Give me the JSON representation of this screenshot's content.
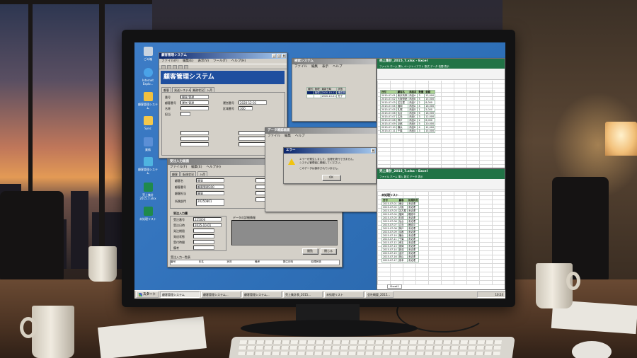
{
  "desktop": {
    "icons": [
      {
        "label": "ごみ箱",
        "icon": "recycle-bin-icon"
      },
      {
        "label": "Internet Explo...",
        "icon": "internet-explorer-icon"
      },
      {
        "label": "顧客管理システム",
        "icon": "app-icon"
      },
      {
        "label": "Sync",
        "icon": "folder-icon"
      },
      {
        "label": "業務",
        "icon": "folder-icon"
      },
      {
        "label": "顧客管理システム",
        "icon": "app-icon"
      },
      {
        "label": "売上集計 2015.7.xlsx",
        "icon": "excel-file-icon"
      },
      {
        "label": "未処理リスト",
        "icon": "excel-file-icon"
      }
    ]
  },
  "main_window": {
    "title": "顧客管理システム",
    "menu": [
      "ファイル(F)",
      "編集(E)",
      "表示(V)",
      "ツール(T)",
      "ヘルプ(H)"
    ],
    "header": "顧客管理システム",
    "tabs": [
      "顧客",
      "発送システム",
      "業務状況",
      "入荷"
    ],
    "labels": [
      "番号",
      "顧客番号",
      "名称",
      "担当"
    ],
    "fields": [
      "開発 管理",
      "運営 管理",
      ""
    ],
    "fields_right_labels": [
      "運営番号",
      "区域番号"
    ],
    "fields_right": [
      "2020-12-01",
      "300"
    ]
  },
  "sub_window": {
    "title": "検索システム",
    "menu": [
      "ファイル",
      "編集",
      "表示",
      "ヘルプ"
    ],
    "headers": [
      "種別",
      "管理",
      "最新日時",
      "状態"
    ],
    "rows": [
      [
        "管理",
        "2020-10-11",
        "確認済"
      ],
      [
        "",
        "2020-10-01",
        "完了"
      ]
    ]
  },
  "input_window": {
    "title": "受注入力画面",
    "menu": [
      "ファイル(F)",
      "編集(E)",
      "ヘルプ(H)"
    ],
    "tabs": [
      "顧客",
      "配達状況",
      "入荷"
    ],
    "labels": [
      "顧客名",
      "顧客番号",
      "顧客担当",
      "所属部門"
    ],
    "fields": [
      "開発",
      "顧客管理300",
      "開発",
      "20250801"
    ],
    "section_labels": [
      "受注入力欄",
      "受注番号",
      "受注日時",
      "発注期限",
      "発送状態",
      "受付時間",
      "備考"
    ],
    "section_fields": [
      "225000",
      "2025-10-01"
    ],
    "data_label": "データの詳細情報",
    "btn_confirm": "閲覧",
    "btn_close": "閉じる",
    "list_title": "受注入力一覧表",
    "list_headers": [
      "番号",
      "氏名",
      "状況",
      "備考",
      "発注日時",
      "処理状態"
    ]
  },
  "dialog": {
    "title": "エラー",
    "parent_title": "データ確認画面",
    "parent_menu": [
      "ファイル",
      "編集",
      "ヘルプ"
    ],
    "message_line1": "エラーが発生しました。処理を続行できません。",
    "message_line2": "システム管理者に連絡してください。",
    "message_line3": "このデータは保存されていません。",
    "ok": "OK"
  },
  "excel_top": {
    "title": "売上集計_2015_7.xlsx - Excel",
    "ribbon_tabs": "ファイル ホーム 挿入 ページレイアウト 数式 データ 校閲 表示",
    "headers": [
      "日付",
      "顧客名",
      "商品名",
      "数量",
      "金額"
    ],
    "rows": [
      [
        "2015-07-01",
        "東京商事",
        "商品A",
        "3",
        "12,000"
      ],
      [
        "2015-07-02",
        "大阪物産",
        "商品B",
        "5",
        "15,000"
      ],
      [
        "2015-07-03",
        "名古屋",
        "商品C",
        "2",
        "8,000"
      ],
      [
        "2015-07-04",
        "福岡",
        "商品A",
        "4",
        "16,000"
      ],
      [
        "2015-07-05",
        "札幌",
        "商品D",
        "1",
        "5,000"
      ],
      [
        "2015-07-06",
        "仙台",
        "商品B",
        "6",
        "18,000"
      ],
      [
        "2015-07-07",
        "広島",
        "商品C",
        "3",
        "12,000"
      ],
      [
        "2015-07-08",
        "神戸",
        "商品A",
        "2",
        "8,000"
      ],
      [
        "2015-07-09",
        "京都",
        "商品E",
        "5",
        "20,000"
      ],
      [
        "2015-07-10",
        "横浜",
        "商品B",
        "4",
        "12,000"
      ],
      [
        "2015-07-11",
        "千葉",
        "商品D",
        "3",
        "15,000"
      ]
    ]
  },
  "excel_bottom": {
    "title": "売上集計_2015_7.xlsx - Excel",
    "ribbon_tabs": "ファイル ホーム 挿入 数式 データ 表示",
    "sheet_title": "未処理リスト",
    "headers": [
      "日付",
      "顧客",
      "処理状況"
    ],
    "rows": [
      [
        "2015-07-01",
        "東京",
        "未処理"
      ],
      [
        "2015-07-02",
        "大阪",
        "未処理"
      ],
      [
        "2015-07-03",
        "名古屋",
        "未処理"
      ],
      [
        "2015-07-04",
        "福岡",
        "確認中"
      ],
      [
        "2015-07-05",
        "札幌",
        "未処理"
      ],
      [
        "2015-07-06",
        "仙台",
        "未処理"
      ],
      [
        "2015-07-07",
        "広島",
        "確認中"
      ],
      [
        "2015-07-08",
        "神戸",
        "未処理"
      ],
      [
        "2015-07-09",
        "京都",
        "未処理"
      ],
      [
        "2015-07-10",
        "横浜",
        "未処理"
      ],
      [
        "2015-07-11",
        "千葉",
        "未処理"
      ],
      [
        "2015-07-12",
        "埼玉",
        "未処理"
      ],
      [
        "2015-07-13",
        "静岡",
        "未処理"
      ],
      [
        "2015-07-14",
        "新潟",
        "未処理"
      ],
      [
        "2015-07-15",
        "金沢",
        "未処理"
      ],
      [
        "2015-07-16",
        "岡山",
        "未処理"
      ],
      [
        "2015-07-17",
        "熊本",
        "未処理"
      ]
    ],
    "sheet_tab": "Sheet1"
  },
  "taskbar": {
    "start": "スタート",
    "tasks": [
      "顧客管理システム",
      "顧客管理システム...",
      "顧客管理システム...",
      "売上集計表_2015...",
      "未処理リスト",
      "会社概要_2015...",
      "未処理リスト_2015...",
      "売上集計表_2015..."
    ],
    "clock": "10:24"
  }
}
